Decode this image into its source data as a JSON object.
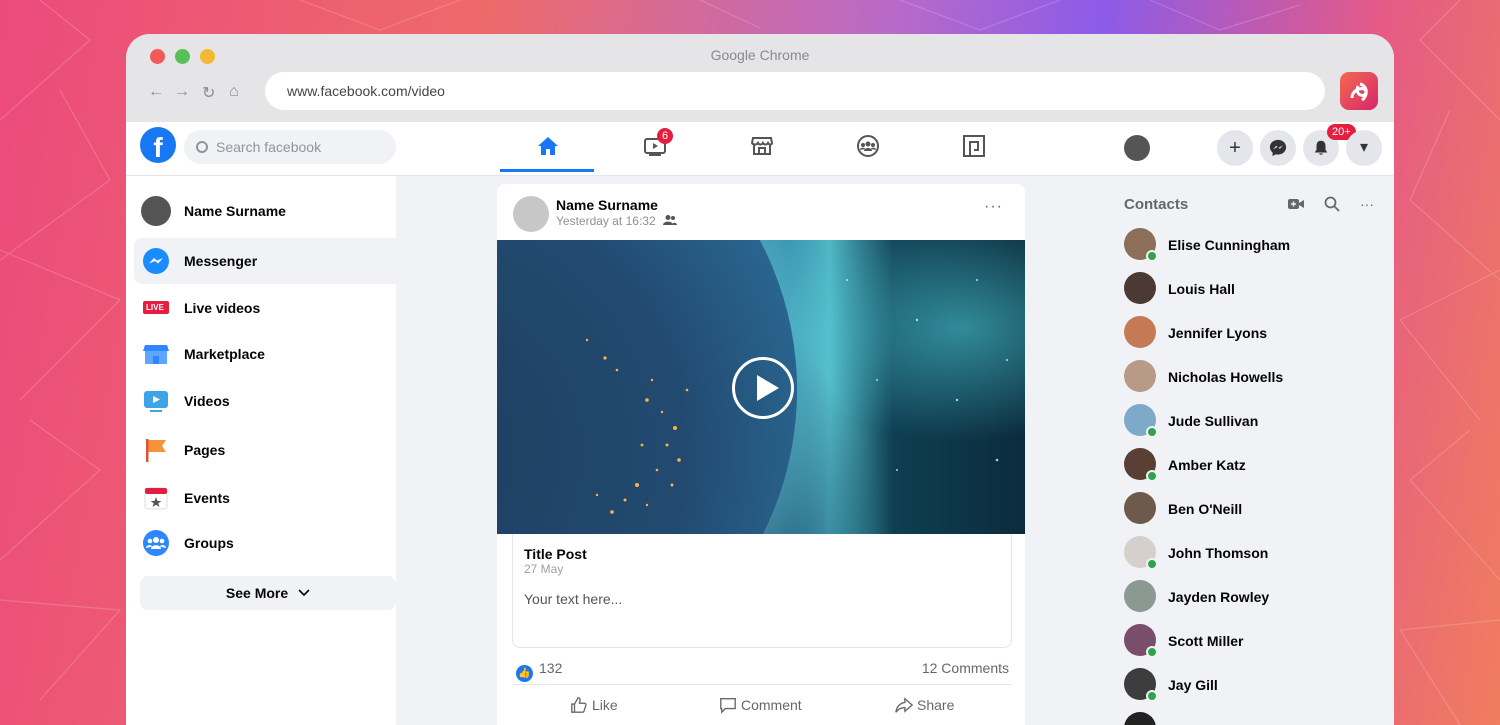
{
  "browser": {
    "title": "Google Chrome",
    "url": "www.facebook.com/video",
    "nav_icons": [
      "back-arrow-icon",
      "forward-arrow-icon",
      "reload-icon",
      "home-icon"
    ]
  },
  "header": {
    "logo": "f",
    "search_placeholder": "Search facebook",
    "tabs": [
      {
        "name": "home",
        "active": true
      },
      {
        "name": "watch",
        "badge": "6"
      },
      {
        "name": "marketplace"
      },
      {
        "name": "groups"
      },
      {
        "name": "gaming"
      }
    ],
    "notifications_badge": "20+",
    "create_label": "+",
    "menu_label": "▾"
  },
  "sidebar": {
    "items": [
      {
        "label": "Name Surname",
        "icon": "avatar"
      },
      {
        "label": "Messenger",
        "icon": "messenger-icon"
      },
      {
        "label": "Live videos",
        "icon": "live-icon",
        "icon_text": "LIVE"
      },
      {
        "label": "Marketplace",
        "icon": "shop-icon"
      },
      {
        "label": "Videos",
        "icon": "video-icon"
      },
      {
        "label": "Pages",
        "icon": "flag-icon"
      },
      {
        "label": "Events",
        "icon": "calendar-icon"
      },
      {
        "label": "Groups",
        "icon": "groups-icon"
      }
    ],
    "see_more": "See More"
  },
  "post": {
    "author": "Name Surname",
    "time": "Yesterday at 16:32",
    "more": "···",
    "link_title": "Title Post",
    "link_date": "27 May",
    "link_text": "Your text here...",
    "likes": "132",
    "comments": "12 Comments",
    "actions": {
      "like": "Like",
      "comment": "Comment",
      "share": "Share"
    }
  },
  "contacts": {
    "title": "Contacts",
    "more": "···",
    "list": [
      {
        "name": "Elise Cunningham",
        "online": true,
        "color": "#8b6f5a"
      },
      {
        "name": "Louis Hall",
        "online": false,
        "color": "#4a3a33"
      },
      {
        "name": "Jennifer Lyons",
        "online": false,
        "color": "#c47a55"
      },
      {
        "name": "Nicholas Howells",
        "online": false,
        "color": "#b89a88"
      },
      {
        "name": "Jude Sullivan",
        "online": true,
        "color": "#7fa9c8"
      },
      {
        "name": "Amber Katz",
        "online": true,
        "color": "#5a3f35"
      },
      {
        "name": "Ben O'Neill",
        "online": false,
        "color": "#6e5a4c"
      },
      {
        "name": "John Thomson",
        "online": true,
        "color": "#d6d0cc"
      },
      {
        "name": "Jayden Rowley",
        "online": false,
        "color": "#8a9a92"
      },
      {
        "name": "Scott Miller",
        "online": true,
        "color": "#7a4d6a"
      },
      {
        "name": "Jay Gill",
        "online": true,
        "color": "#3d3d3d"
      }
    ]
  }
}
